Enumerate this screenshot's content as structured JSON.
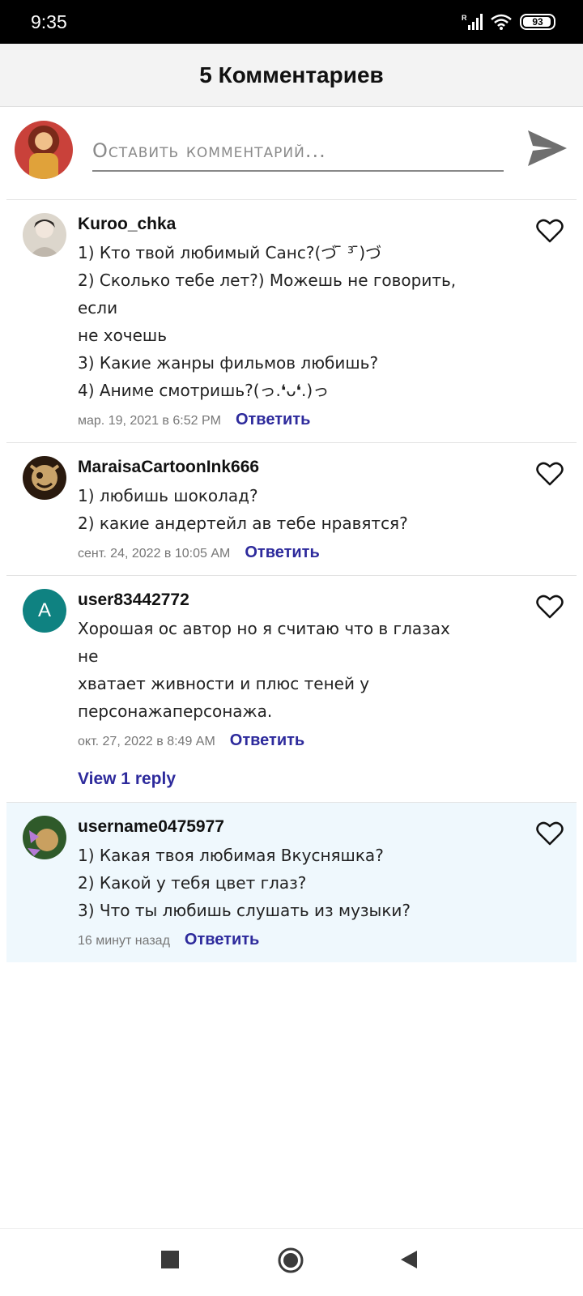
{
  "status_bar": {
    "time": "9:35",
    "battery": "93",
    "icons": [
      "signal-icon",
      "wifi-icon",
      "battery-icon"
    ]
  },
  "header": {
    "title": "5 Комментариев"
  },
  "composer": {
    "placeholder": "Оставить комментарий...",
    "send_icon": "send-icon"
  },
  "comments": [
    {
      "author": "Kuroo_chka",
      "lines": [
        "1) Кто твой любимый Санс?(づ ̄ ³ ̄)づ",
        "2) Сколько тебе лет?) Можешь не говорить, если",
        "не хочешь",
        "3) Какие жанры фильмов любишь?",
        "4) Аниме смотришь?(っ.❛ᴗ❛.)っ"
      ],
      "date": "мар. 19, 2021 в 6:52 PM",
      "reply_label": "Ответить"
    },
    {
      "author": "MaraisaCartoonInk666",
      "lines": [
        "1) любишь шоколад?",
        "2) какие андертейл ав тебе нравятся?"
      ],
      "date": "сент. 24, 2022 в 10:05 AM",
      "reply_label": "Ответить"
    },
    {
      "author": "user83442772",
      "avatar_letter": "A",
      "lines": [
        "Хорошая ос автор но я считаю что в глазах не",
        "хватает живности и плюс теней у",
        "персонажаперсонажа."
      ],
      "date": "окт. 27, 2022 в 8:49 AM",
      "reply_label": "Ответить",
      "view_replies": "View 1 reply"
    },
    {
      "author": "username0475977",
      "lines": [
        "1) Какая твоя любимая Вкусняшка?",
        "2) Какой у тебя цвет глаз?",
        "3) Что ты любишь слушать из музыки?"
      ],
      "date": "16 минут назад",
      "reply_label": "Ответить"
    }
  ],
  "colors": {
    "accent": "#2d2a9c",
    "highlight_bg": "#eff8fd",
    "avatar_teal": "#0f8281"
  },
  "nav": [
    "recents-square-icon",
    "home-circle-icon",
    "back-triangle-icon"
  ]
}
